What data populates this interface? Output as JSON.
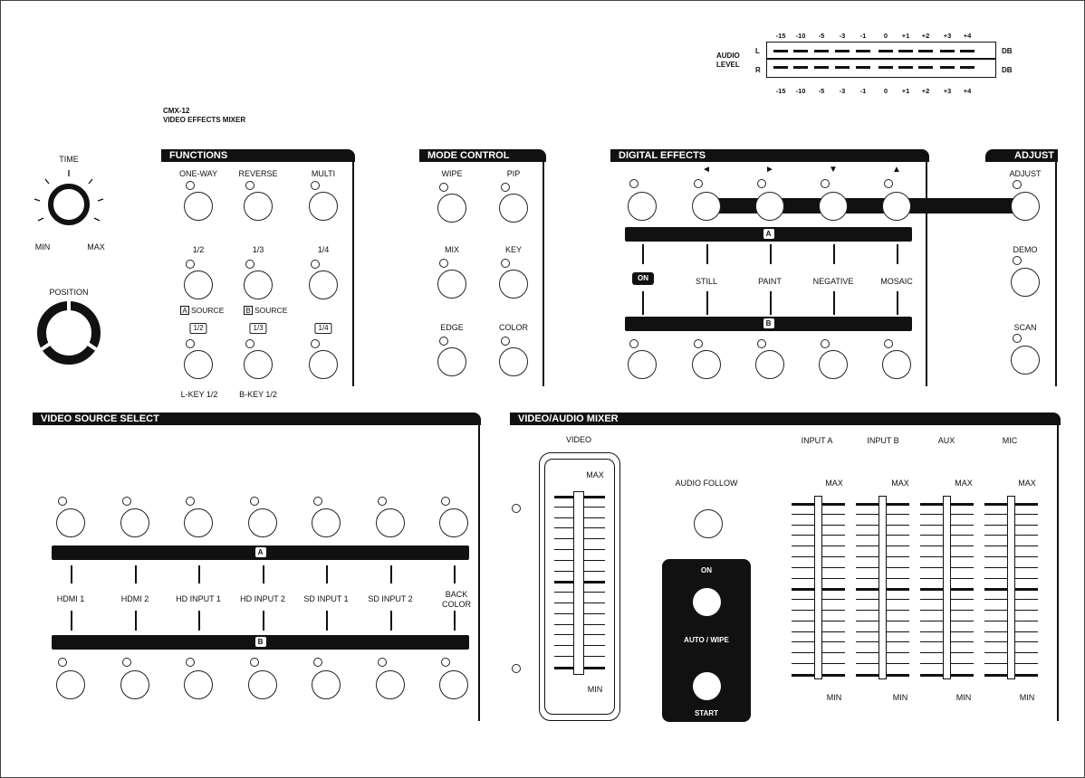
{
  "device": {
    "model": "CMX-12",
    "name": "VIDEO EFFECTS MIXER"
  },
  "audio_level": {
    "label_line1": "AUDIO",
    "label_line2": "LEVEL",
    "scale": [
      "-15",
      "-10",
      "-5",
      "-3",
      "-1",
      "0",
      "+1",
      "+2",
      "+3",
      "+4"
    ],
    "left": "L",
    "right": "R",
    "unit": "DB"
  },
  "knobs": {
    "time": "TIME",
    "min": "MIN",
    "max": "MAX",
    "position": "POSITION"
  },
  "functions": {
    "title": "FUNCTIONS",
    "row1": [
      "ONE-WAY",
      "REVERSE",
      "MULTI"
    ],
    "row2": [
      "1/2",
      "1/3",
      "1/4"
    ],
    "source_a_badge": "A",
    "source_a": "SOURCE",
    "source_b_badge": "B",
    "source_b": "SOURCE",
    "row3": [
      "1/2",
      "1/3",
      "1/4"
    ],
    "bottom": [
      "L-KEY 1/2",
      "B-KEY 1/2"
    ]
  },
  "mode_control": {
    "title": "MODE CONTROL",
    "labels": [
      "WIPE",
      "PIP",
      "MIX",
      "KEY",
      "EDGE",
      "COLOR"
    ]
  },
  "digital_effects": {
    "title": "DIGITAL EFFECTS",
    "arrows": [
      "◄",
      "►",
      "▼",
      "▲"
    ],
    "bar_a": "A",
    "bar_b": "B",
    "on": "ON",
    "labels": [
      "STILL",
      "PAINT",
      "NEGATIVE",
      "MOSAIC"
    ]
  },
  "adjust": {
    "title": "ADJUST",
    "labels": [
      "ADJUST",
      "DEMO",
      "SCAN"
    ]
  },
  "video_source": {
    "title": "VIDEO SOURCE SELECT",
    "bar_a": "A",
    "bar_b": "B",
    "inputs": [
      "HDMI 1",
      "HDMI 2",
      "HD INPUT 1",
      "HD INPUT 2",
      "SD INPUT 1",
      "SD INPUT 2"
    ],
    "back_color_1": "BACK",
    "back_color_2": "COLOR"
  },
  "mixer": {
    "title": "VIDEO/AUDIO MIXER",
    "video": "VIDEO",
    "max": "MAX",
    "min": "MIN",
    "audio_follow": "AUDIO FOLLOW",
    "on": "ON",
    "auto_wipe": "AUTO / WIPE",
    "start": "START",
    "channels": [
      "INPUT A",
      "INPUT B",
      "AUX",
      "MIC"
    ]
  }
}
